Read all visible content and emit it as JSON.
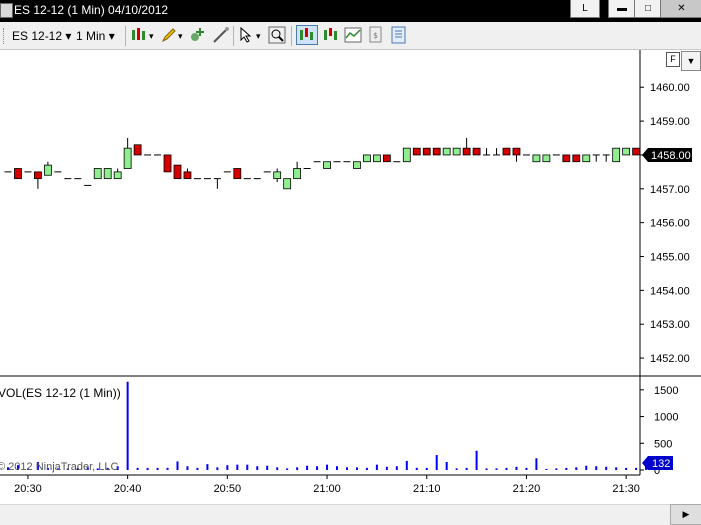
{
  "window": {
    "title": "ES 12-12 (1 Min)  04/10/2012",
    "link_label": "L",
    "minimize_glyph": "▬",
    "maximize_glyph": "□",
    "close_glyph": "✕"
  },
  "toolbar": {
    "instrument": "ES 12-12",
    "interval": "1 Min",
    "icons": [
      "bars-type-icon",
      "draw-pencil-icon",
      "add-indicator-icon",
      "cursor-select-icon",
      "zoom-icon",
      "chart-trader-icon",
      "data-box-icon",
      "strategies-icon",
      "properties-icon"
    ]
  },
  "panel_buttons": {
    "f_label": "F",
    "dropdown_glyph": "▼"
  },
  "chart_data": {
    "type": "candlestick",
    "instrument": "ES 12-12",
    "interval": "1 Min",
    "date": "04/10/2012",
    "price_axis": {
      "ticks": [
        "1460.00",
        "1459.00",
        "1458.00",
        "1457.00",
        "1456.00",
        "1455.00",
        "1454.00",
        "1453.00",
        "1452.00"
      ],
      "ylim": [
        1451.5,
        1461.1
      ],
      "last_price": "1458.00"
    },
    "time_axis": {
      "ticks": [
        "20:30",
        "20:40",
        "20:50",
        "21:00",
        "21:10",
        "21:20",
        "21:30"
      ]
    },
    "bars": [
      [
        1457.5,
        1457.5,
        1457.5,
        1457.5
      ],
      [
        1457.6,
        1457.6,
        1457.3,
        1457.3
      ],
      [
        1457.5,
        1457.5,
        1457.5,
        1457.5
      ],
      [
        1457.5,
        1457.5,
        1457.0,
        1457.3
      ],
      [
        1457.4,
        1457.8,
        1457.4,
        1457.7
      ],
      [
        1457.5,
        1457.5,
        1457.5,
        1457.5
      ],
      [
        1457.3,
        1457.3,
        1457.3,
        1457.3
      ],
      [
        1457.3,
        1457.3,
        1457.3,
        1457.3
      ],
      [
        1457.1,
        1457.1,
        1457.1,
        1457.1
      ],
      [
        1457.3,
        1457.6,
        1457.3,
        1457.6
      ],
      [
        1457.3,
        1457.6,
        1457.3,
        1457.6
      ],
      [
        1457.3,
        1457.6,
        1457.3,
        1457.5
      ],
      [
        1457.6,
        1458.5,
        1457.6,
        1458.2
      ],
      [
        1458.3,
        1458.3,
        1458.0,
        1458.0
      ],
      [
        1458.0,
        1458.0,
        1458.0,
        1458.0
      ],
      [
        1458.0,
        1458.0,
        1458.0,
        1458.0
      ],
      [
        1458.0,
        1458.0,
        1457.5,
        1457.5
      ],
      [
        1457.7,
        1457.7,
        1457.3,
        1457.3
      ],
      [
        1457.5,
        1457.6,
        1457.3,
        1457.3
      ],
      [
        1457.3,
        1457.3,
        1457.3,
        1457.3
      ],
      [
        1457.3,
        1457.3,
        1457.3,
        1457.3
      ],
      [
        1457.3,
        1457.3,
        1457.0,
        1457.3
      ],
      [
        1457.5,
        1457.5,
        1457.5,
        1457.5
      ],
      [
        1457.6,
        1457.6,
        1457.3,
        1457.3
      ],
      [
        1457.3,
        1457.3,
        1457.3,
        1457.3
      ],
      [
        1457.3,
        1457.3,
        1457.3,
        1457.3
      ],
      [
        1457.5,
        1457.5,
        1457.5,
        1457.5
      ],
      [
        1457.3,
        1457.6,
        1457.2,
        1457.5
      ],
      [
        1457.0,
        1457.3,
        1457.0,
        1457.3
      ],
      [
        1457.3,
        1457.8,
        1457.3,
        1457.6
      ],
      [
        1457.6,
        1457.6,
        1457.6,
        1457.6
      ],
      [
        1457.8,
        1457.8,
        1457.8,
        1457.8
      ],
      [
        1457.6,
        1457.8,
        1457.6,
        1457.8
      ],
      [
        1457.8,
        1457.8,
        1457.8,
        1457.8
      ],
      [
        1457.8,
        1457.8,
        1457.8,
        1457.8
      ],
      [
        1457.6,
        1457.8,
        1457.6,
        1457.8
      ],
      [
        1457.8,
        1458.0,
        1457.8,
        1458.0
      ],
      [
        1457.8,
        1458.0,
        1457.8,
        1458.0
      ],
      [
        1458.0,
        1458.0,
        1457.8,
        1457.8
      ],
      [
        1457.8,
        1457.8,
        1457.8,
        1457.8
      ],
      [
        1457.8,
        1458.2,
        1457.8,
        1458.2
      ],
      [
        1458.2,
        1458.2,
        1458.0,
        1458.0
      ],
      [
        1458.2,
        1458.2,
        1458.0,
        1458.0
      ],
      [
        1458.2,
        1458.2,
        1458.0,
        1458.0
      ],
      [
        1458.0,
        1458.2,
        1458.0,
        1458.2
      ],
      [
        1458.0,
        1458.2,
        1458.0,
        1458.2
      ],
      [
        1458.2,
        1458.5,
        1458.0,
        1458.0
      ],
      [
        1458.2,
        1458.2,
        1458.0,
        1458.0
      ],
      [
        1458.0,
        1458.2,
        1458.0,
        1458.0
      ],
      [
        1458.0,
        1458.2,
        1458.0,
        1458.0
      ],
      [
        1458.2,
        1458.2,
        1458.0,
        1458.0
      ],
      [
        1458.2,
        1458.2,
        1457.8,
        1458.0
      ],
      [
        1458.0,
        1458.0,
        1458.0,
        1458.0
      ],
      [
        1457.8,
        1458.0,
        1457.8,
        1458.0
      ],
      [
        1457.8,
        1458.0,
        1457.8,
        1458.0
      ],
      [
        1458.0,
        1458.0,
        1458.0,
        1458.0
      ],
      [
        1458.0,
        1458.0,
        1457.8,
        1457.8
      ],
      [
        1458.0,
        1458.0,
        1457.8,
        1457.8
      ],
      [
        1457.8,
        1458.0,
        1457.8,
        1458.0
      ],
      [
        1458.0,
        1458.0,
        1457.8,
        1458.0
      ],
      [
        1458.0,
        1458.0,
        1457.8,
        1458.0
      ],
      [
        1457.8,
        1458.2,
        1457.8,
        1458.2
      ],
      [
        1458.0,
        1458.2,
        1458.0,
        1458.2
      ],
      [
        1458.2,
        1458.2,
        1458.0,
        1458.0
      ],
      [
        1458.0,
        1458.0,
        1458.0,
        1458.0
      ]
    ],
    "volume": {
      "label": "VOL(ES 12-12 (1 Min))",
      "ticks": [
        "1500",
        "1000",
        "500",
        "0"
      ],
      "ylim": [
        0,
        1740
      ],
      "last_value": "132",
      "values": [
        50,
        90,
        30,
        150,
        40,
        30,
        30,
        40,
        50,
        30,
        40,
        70,
        1650,
        40,
        40,
        40,
        40,
        160,
        70,
        40,
        110,
        50,
        90,
        100,
        100,
        70,
        80,
        50,
        30,
        50,
        80,
        70,
        100,
        70,
        50,
        50,
        40,
        100,
        60,
        70,
        170,
        40,
        40,
        280,
        150,
        30,
        40,
        360,
        30,
        30,
        40,
        60,
        40,
        220,
        20,
        30,
        40,
        50,
        80,
        70,
        60,
        50,
        40,
        40,
        110
      ]
    },
    "copyright": "© 2012 NinjaTrader, LLC"
  },
  "colors": {
    "up_bar": "#90ee90",
    "down_bar": "#d40000",
    "volume_bar": "#0000ff",
    "last_price_bg": "#000000",
    "last_volume_bg": "#0000cc"
  }
}
